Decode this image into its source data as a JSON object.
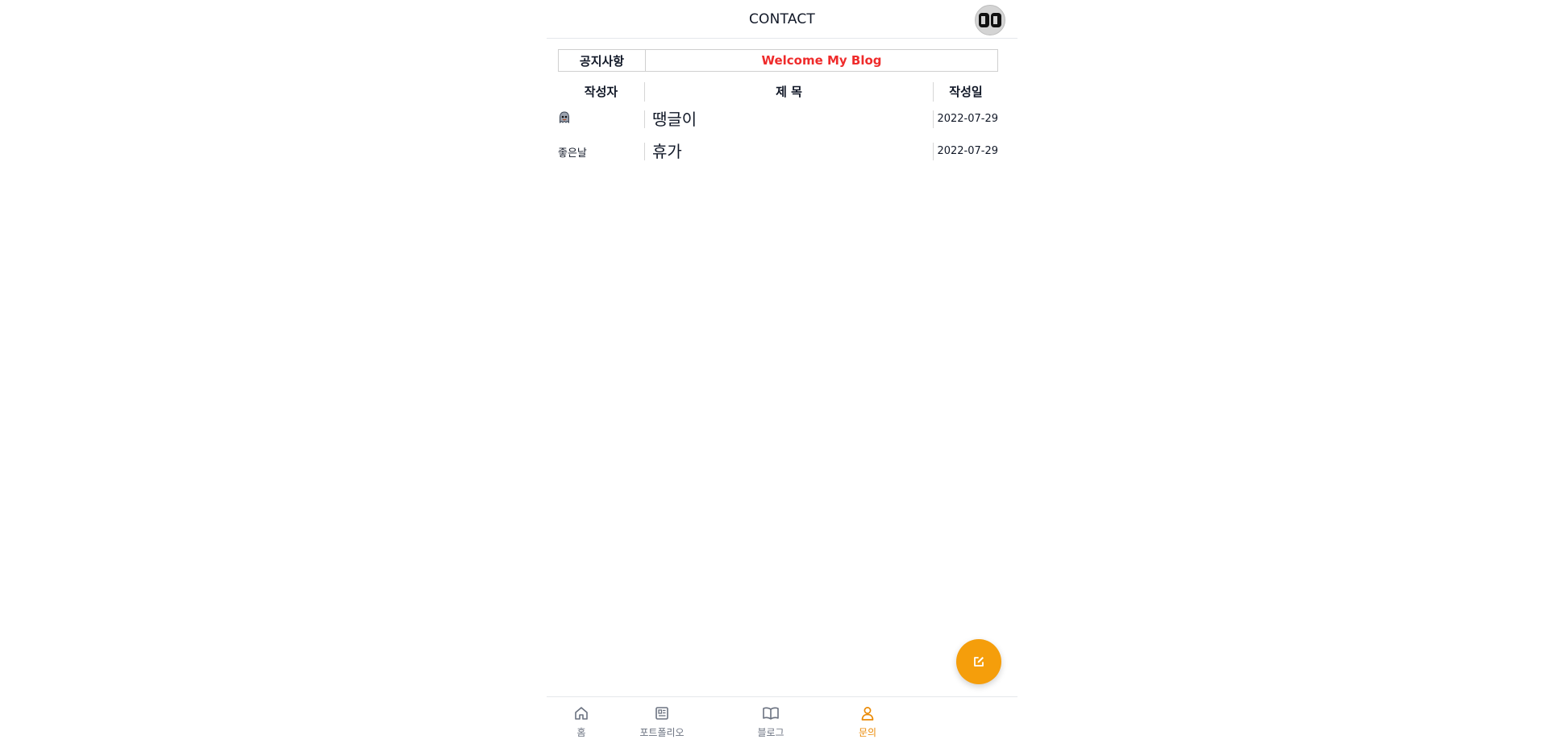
{
  "header": {
    "title": "CONTACT",
    "avatar_text": "DB"
  },
  "notice": {
    "label": "공지사항",
    "text": "Welcome My Blog"
  },
  "table": {
    "columns": {
      "author": "작성자",
      "title": "제 목",
      "date": "작성일"
    },
    "rows": [
      {
        "author_icon": "ghost-icon",
        "title": "땡글이",
        "date": "2022-07-29"
      },
      {
        "author": "좋은날",
        "title": "휴가",
        "date": "2022-07-29"
      }
    ]
  },
  "fab": {
    "icon": "edit-icon"
  },
  "bottom_nav": {
    "items": [
      {
        "label": "홈",
        "icon": "home-icon"
      },
      {
        "label": "포트폴리오",
        "icon": "newspaper-icon"
      },
      {
        "label": "블로그",
        "icon": "book-icon"
      },
      {
        "label": "문의",
        "icon": "user-icon",
        "active": true
      }
    ]
  },
  "colors": {
    "accent": "#f59e0b",
    "active_nav": "#ea8a06",
    "notice_text": "#ef2b2b"
  }
}
